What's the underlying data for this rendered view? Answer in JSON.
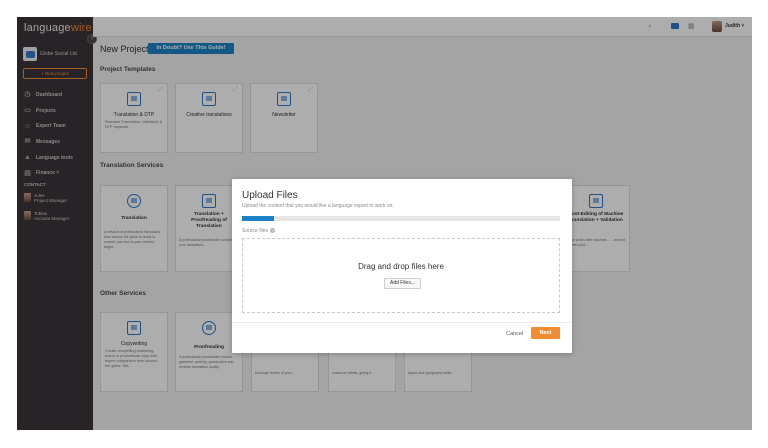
{
  "brand": {
    "logo_a": "language",
    "logo_b": "wire"
  },
  "sidebar": {
    "company": "Globe Social Ltd.",
    "new_project": "+ New project",
    "items": [
      {
        "label": "Dashboard",
        "icon": "dashboard-icon"
      },
      {
        "label": "Projects",
        "icon": "folder-icon"
      },
      {
        "label": "Expert Team",
        "icon": "team-icon"
      },
      {
        "label": "Messages",
        "icon": "message-icon"
      },
      {
        "label": "Language tools",
        "icon": "language-tools-icon"
      },
      {
        "label": "Finance ˅",
        "icon": "finance-icon"
      }
    ],
    "contact_heading": "CONTACT",
    "contacts": [
      {
        "name": "Jules",
        "role": "Project Manager"
      },
      {
        "name": "Tobias",
        "role": "Account Manager"
      }
    ]
  },
  "topbar": {
    "user": "Judith ˅",
    "icons": [
      "search-icon",
      "notification-icon",
      "grid-icon",
      "avatar"
    ]
  },
  "main": {
    "title": "New Project",
    "guide_button": "In Doubt? Use This Guide!",
    "sections": {
      "templates": "Project Templates",
      "translation": "Translation Services",
      "other": "Other Services"
    },
    "template_cards": [
      {
        "title": "Translation & DTP",
        "desc": "Standard Translation, Validation & DTP requests"
      },
      {
        "title": "Creative translations",
        "desc": ""
      },
      {
        "title": "Newsletter",
        "desc": ""
      }
    ],
    "translation_cards": [
      {
        "title": "Translation",
        "desc": "A network of professional translators from around the globe is ready to convert your text to your desired target..."
      },
      {
        "title": "Translation + Proofreading of Translation",
        "desc": "A professional proofreader scrutinizes your translation..."
      },
      {
        "title": "Post-Editing of Machine Translation + Validation",
        "desc": "...ator works with machine-... ...ed text to meet your..."
      }
    ],
    "other_cards": [
      {
        "title": "Copywriting",
        "desc": "Create compelling marketing, brand or promotional copy with expert copywriters from around the globe. We..."
      },
      {
        "title": "Proofreading",
        "desc": "A professional proofreader checks grammar, spelling, punctuation and reviews translation quality."
      }
    ],
    "peek_texts": [
      "thorough review of your...",
      "voiceover artists, giving it...",
      "layout and typography skills..."
    ]
  },
  "modal": {
    "title": "Upload Files",
    "subtitle": "Upload the content that you would like a language expert to work on.",
    "progress": 0.1,
    "source_files_label": "Source files",
    "help": "?",
    "drop_text": "Drag and drop files here",
    "add_files": "Add Files...",
    "cancel": "Cancel",
    "next": "Next"
  },
  "colors": {
    "accent": "#f28c33",
    "primary": "#1c84c6",
    "sidebar": "#3a3438"
  }
}
